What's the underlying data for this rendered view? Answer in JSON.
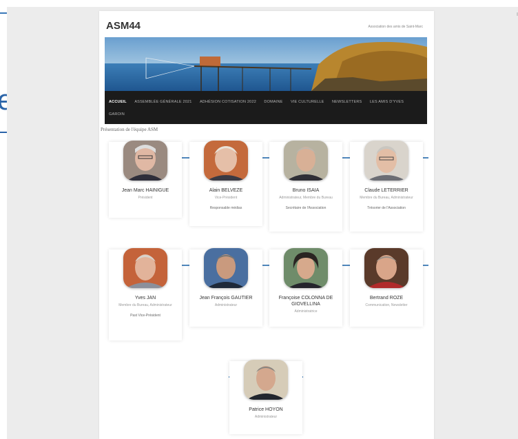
{
  "site": {
    "title": "ASM44",
    "description": "Association des amis de Saint-Marc"
  },
  "nav": {
    "items": [
      {
        "label": "ACCUEIL",
        "active": true
      },
      {
        "label": "ASSEMBLÉE GÉNÉRALE 2021",
        "active": false
      },
      {
        "label": "ADHÉSION COTISATION 2022",
        "active": false
      },
      {
        "label": "DOMAINE",
        "active": false
      },
      {
        "label": "VIE CULTURELLE",
        "active": false
      },
      {
        "label": "NEWSLETTERS",
        "active": false
      },
      {
        "label": "LES AMIS D'YVES",
        "active": false
      },
      {
        "label": "GAROIN",
        "active": false
      }
    ]
  },
  "section_title": "Présentation de l'équipe ASM",
  "members": [
    {
      "name": "Jean Marc HAINIGUE",
      "role": "Président",
      "extra": ""
    },
    {
      "name": "Alain BELVEZE",
      "role": "Vice-Président",
      "extra": "Responsable médias"
    },
    {
      "name": "Bruno ISAIA",
      "role": "Administrateur, Membre du Bureau",
      "extra": "Secrétaire de l'Association"
    },
    {
      "name": "Claude LETERRIER",
      "role": "Membre du Bureau, Administrateur",
      "extra": "Trésorier de l'Association"
    },
    {
      "name": "Yves JAN",
      "role": "Membre du Bureau, Administrateur",
      "extra": "Past Vice-Président"
    },
    {
      "name": "Jean François GAUTIER",
      "role": "Administrateur",
      "extra": ""
    },
    {
      "name": "Françoise COLONNA DE GIOVELLINA",
      "role": "Administratrice",
      "extra": ""
    },
    {
      "name": "Bertrand ROZE",
      "role": "Communication, Newsletter",
      "extra": ""
    },
    {
      "name": "Patrice HOYON",
      "role": "Administrateur",
      "extra": ""
    }
  ],
  "edge_fragment": {
    "glyph": "e"
  },
  "colors": {
    "accent": "#4f87bd",
    "navbar_bg": "#1b1b1b",
    "background": "#ececec"
  }
}
